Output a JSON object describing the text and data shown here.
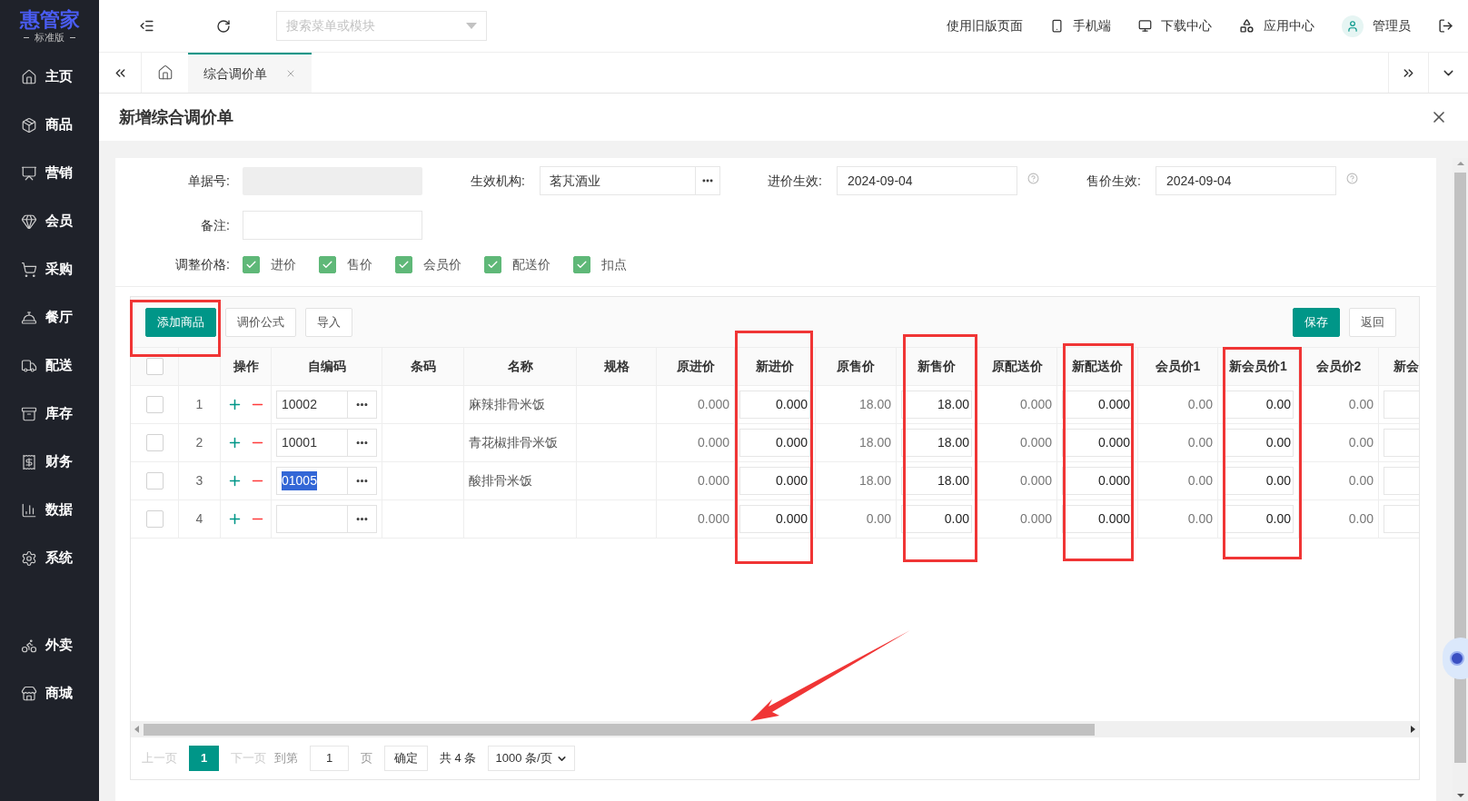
{
  "logo": {
    "name": "惠管家",
    "edition": "标准版"
  },
  "sidebar": {
    "groups": [
      {
        "items": [
          {
            "label": "主页"
          },
          {
            "label": "商品"
          },
          {
            "label": "营销"
          },
          {
            "label": "会员"
          },
          {
            "label": "采购"
          },
          {
            "label": "餐厅"
          },
          {
            "label": "配送"
          },
          {
            "label": "库存"
          },
          {
            "label": "财务"
          },
          {
            "label": "数据"
          },
          {
            "label": "系统"
          }
        ]
      },
      {
        "items": [
          {
            "label": "外卖"
          },
          {
            "label": "商城"
          }
        ]
      }
    ]
  },
  "topbar": {
    "search": {
      "placeholder": "搜索菜单或模块"
    },
    "links": [
      {
        "kind": "text",
        "label": "使用旧版页面"
      },
      {
        "kind": "phone",
        "label": "手机端"
      },
      {
        "kind": "download",
        "label": "下载中心"
      },
      {
        "kind": "apps",
        "label": "应用中心"
      },
      {
        "kind": "user",
        "label": "管理员"
      }
    ]
  },
  "tabs": [
    {
      "label": "综合调价单",
      "selected": true
    }
  ],
  "dialog": {
    "title": "新增综合调价单"
  },
  "form": {
    "doc_no": {
      "label": "单据号:"
    },
    "org": {
      "label": "生效机构:",
      "value": "茗芃酒业"
    },
    "purchase_effective": {
      "label": "进价生效:",
      "value": "2024-09-04"
    },
    "sale_effective": {
      "label": "售价生效:",
      "value": "2024-09-04"
    },
    "remark": {
      "label": "备注:"
    },
    "adjust_prices": {
      "label": "调整价格:",
      "options": [
        {
          "label": "进价",
          "checked": true
        },
        {
          "label": "售价",
          "checked": true
        },
        {
          "label": "会员价",
          "checked": true
        },
        {
          "label": "配送价",
          "checked": true
        },
        {
          "label": "扣点",
          "checked": true
        }
      ]
    }
  },
  "toolbar": {
    "left": [
      {
        "label": "添加商品",
        "kind": "primary"
      },
      {
        "label": "调价公式",
        "kind": "default"
      },
      {
        "label": "导入",
        "kind": "default"
      }
    ],
    "right": [
      {
        "label": "保存",
        "kind": "primary"
      },
      {
        "label": "返回",
        "kind": "default"
      }
    ]
  },
  "table": {
    "columns": [
      {
        "kind": "select",
        "checked": false
      },
      {
        "kind": "index"
      },
      {
        "kind": "ops",
        "label": "操作"
      },
      {
        "kind": "code",
        "label": "自编码"
      },
      {
        "kind": "barcode",
        "label": "条码"
      },
      {
        "kind": "name",
        "label": "名称"
      },
      {
        "kind": "spec",
        "label": "规格"
      },
      {
        "kind": "price",
        "label": "原进价"
      },
      {
        "kind": "price_input",
        "label": "新进价"
      },
      {
        "kind": "price",
        "label": "原售价"
      },
      {
        "kind": "price_input",
        "label": "新售价"
      },
      {
        "kind": "price",
        "label": "原配送价"
      },
      {
        "kind": "price_input",
        "label": "新配送价"
      },
      {
        "kind": "price",
        "label": "会员价1"
      },
      {
        "kind": "price_input",
        "label": "新会员价1"
      },
      {
        "kind": "price",
        "label": "会员价2"
      },
      {
        "kind": "price_input",
        "label": "新会"
      }
    ],
    "rows": [
      {
        "checked": false,
        "index": "1",
        "code": "10002",
        "code_selected": false,
        "name": "麻辣排骨米饭",
        "prices": [
          "0.000",
          "0.000",
          "18.00",
          "18.00",
          "0.000",
          "0.000",
          "0.00",
          "0.00",
          "0.00"
        ]
      },
      {
        "checked": false,
        "index": "2",
        "code": "10001",
        "code_selected": false,
        "name": "青花椒排骨米饭",
        "prices": [
          "0.000",
          "0.000",
          "18.00",
          "18.00",
          "0.000",
          "0.000",
          "0.00",
          "0.00",
          "0.00"
        ]
      },
      {
        "checked": false,
        "index": "3",
        "code": "01005",
        "code_selected": true,
        "name": "酸排骨米饭",
        "prices": [
          "0.000",
          "0.000",
          "18.00",
          "18.00",
          "0.000",
          "0.000",
          "0.00",
          "0.00",
          "0.00"
        ]
      },
      {
        "checked": false,
        "index": "4",
        "prices": [
          "0.000",
          "0.000",
          "0.00",
          "0.00",
          "0.000",
          "0.000",
          "0.00",
          "0.00",
          "0.00"
        ]
      }
    ]
  },
  "pagination": {
    "prev": {
      "label": "上一页",
      "disabled": true
    },
    "pages": [
      {
        "label": "1",
        "selected": true
      }
    ],
    "next": {
      "label": "下一页",
      "disabled": true
    },
    "goto_label": "到第",
    "goto_value": "1",
    "page_unit": "页",
    "confirm": "确定",
    "total": "共 4 条",
    "page_size": "1000 条/页"
  }
}
